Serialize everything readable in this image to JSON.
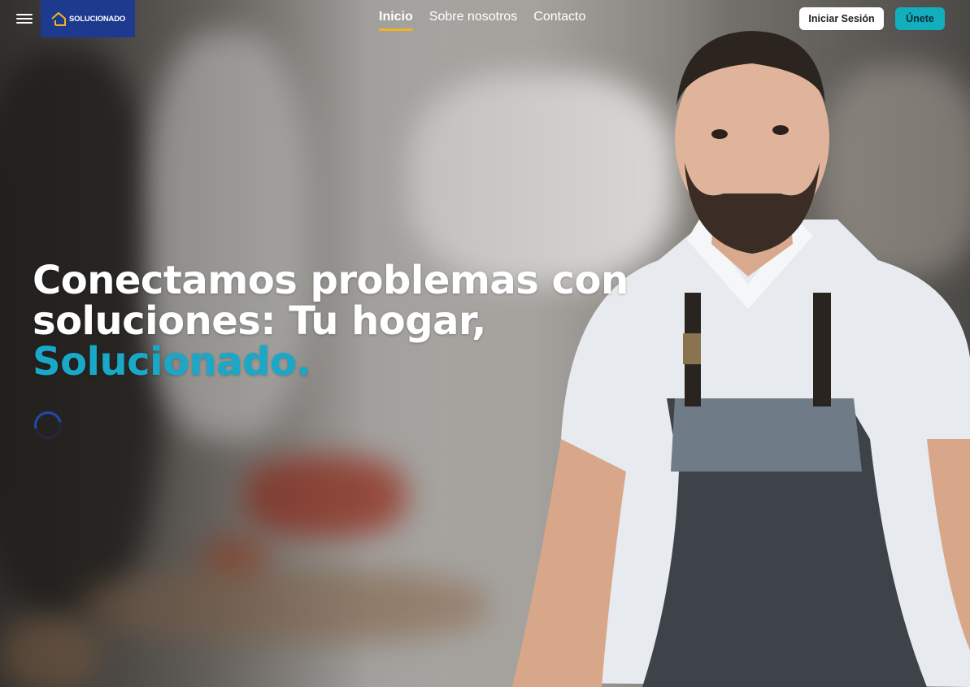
{
  "header": {
    "logo_text": "SOLUCIONADO",
    "nav": [
      "Inicio",
      "Sobre nosotros",
      "Contacto"
    ],
    "active_nav": "Inicio",
    "login_label": "Iniciar Sesión",
    "join_label": "Únete"
  },
  "hero": {
    "title_line1": "Conectamos problemas con",
    "title_line2": "soluciones: Tu hogar,",
    "title_accent": "Solucionado."
  },
  "colors": {
    "brand_blue": "#1d3a8f",
    "accent_teal": "#12aebd",
    "title_accent": "#1aa8c9",
    "nav_underline": "#f0b323"
  },
  "icons": [
    "menu-icon",
    "house-logo-icon",
    "loading-spinner-icon"
  ]
}
